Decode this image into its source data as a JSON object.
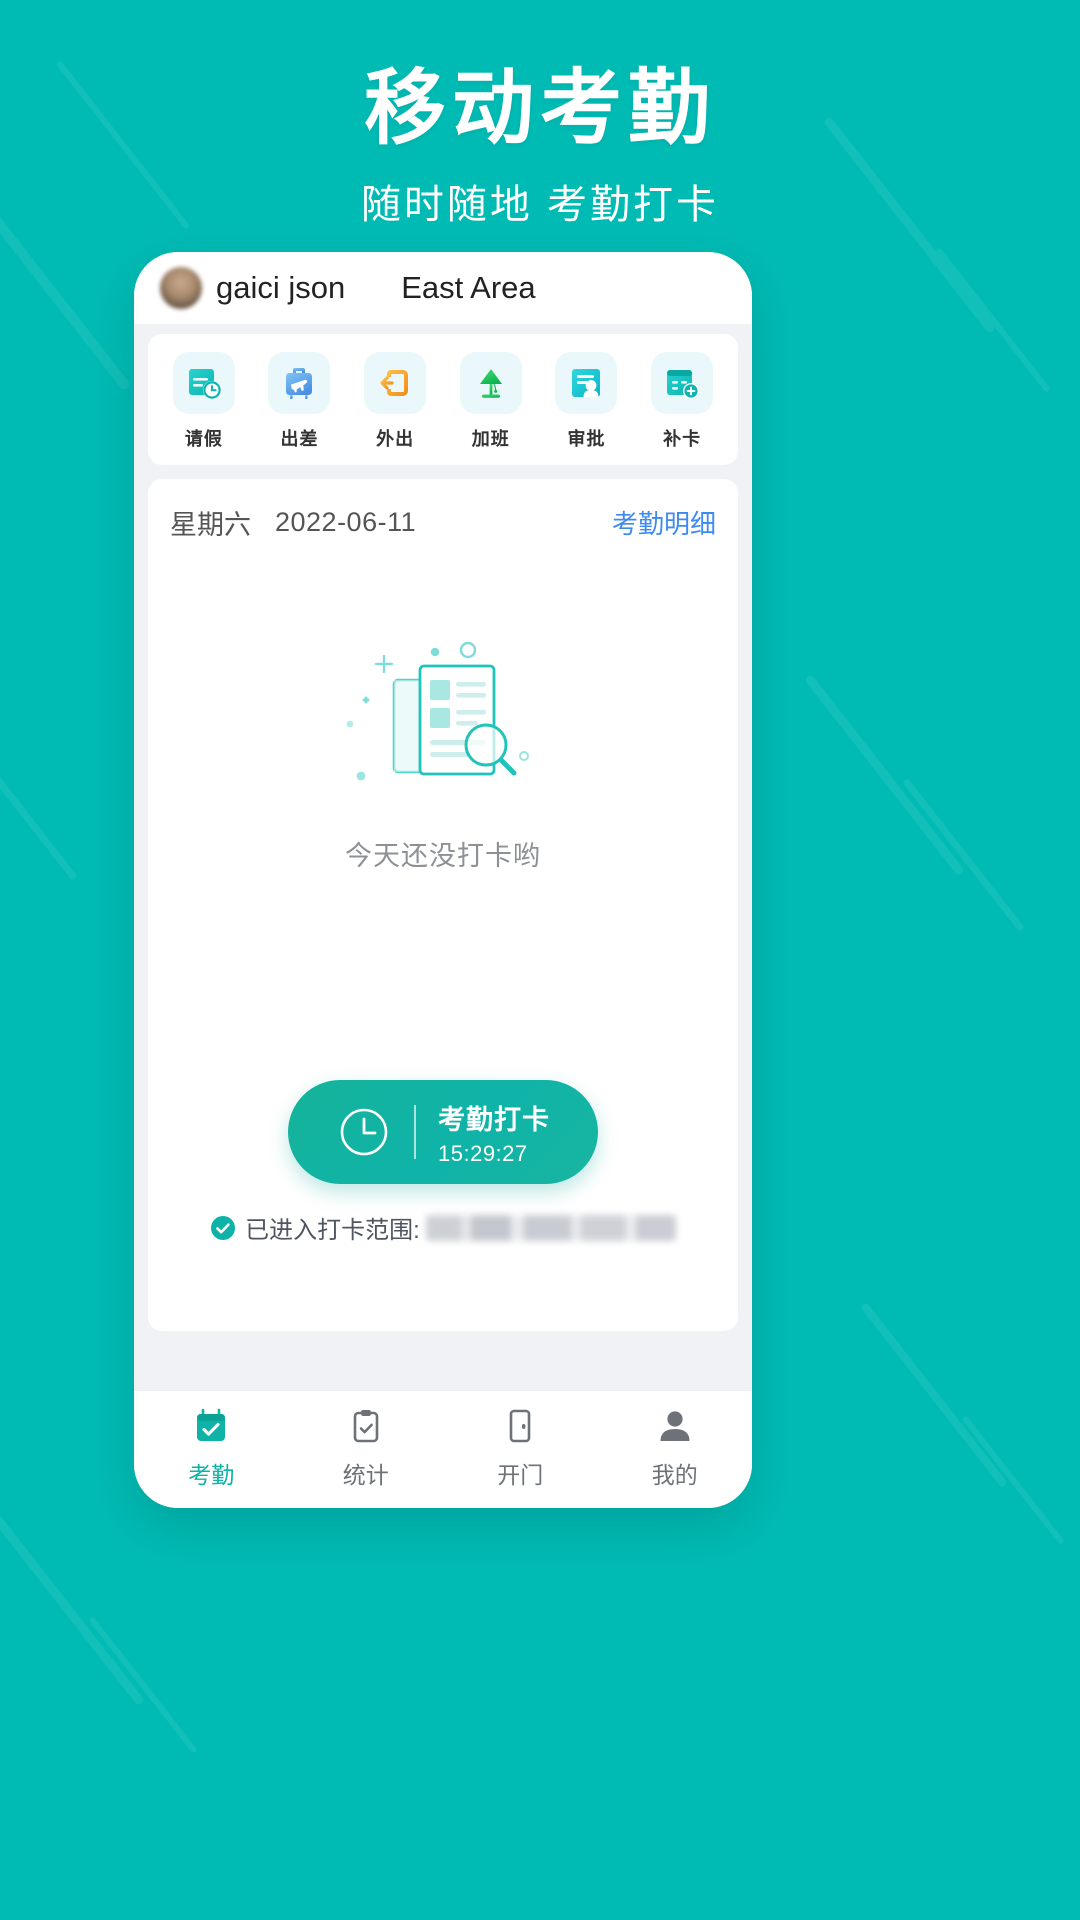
{
  "poster": {
    "title": "移动考勤",
    "subtitle": "随时随地  考勤打卡",
    "brand_color": "#00BBB4"
  },
  "phone": {
    "header": {
      "avatar": "user-avatar",
      "user_name": "gaici json",
      "area_name": "East Area"
    },
    "quick_actions": [
      {
        "label": "请假",
        "icon": "calendar-clock-icon",
        "color": "#15c0c0"
      },
      {
        "label": "出差",
        "icon": "suitcase-plane-icon",
        "color": "#5aa8f0"
      },
      {
        "label": "外出",
        "icon": "door-exit-icon",
        "color": "#f6a321"
      },
      {
        "label": "加班",
        "icon": "desk-lamp-icon",
        "color": "#1bbf5a"
      },
      {
        "label": "审批",
        "icon": "document-person-icon",
        "color": "#16c3d4"
      },
      {
        "label": "补卡",
        "icon": "calendar-plus-icon",
        "color": "#15c0c0"
      }
    ],
    "attendance": {
      "weekday": "星期六",
      "date": "2022-06-11",
      "detail_link": "考勤明细",
      "empty_text": "今天还没打卡哟",
      "empty_illustration": "document-search-empty-icon",
      "punch_button": {
        "icon": "clock-icon",
        "label": "考勤打卡",
        "time": "15:29:27",
        "color": "#0fb3a8"
      },
      "range_status": {
        "icon": "check-circle-icon",
        "label": "已进入打卡范围:",
        "location": "",
        "icon_color": "#0DB3A6"
      }
    },
    "tabbar": [
      {
        "label": "考勤",
        "icon": "attendance-calendar-icon",
        "active": true
      },
      {
        "label": "统计",
        "icon": "clipboard-stats-icon",
        "active": false
      },
      {
        "label": "开门",
        "icon": "door-open-icon",
        "active": false
      },
      {
        "label": "我的",
        "icon": "person-icon",
        "active": false
      }
    ],
    "active_color": "#0DB3A6",
    "inactive_color": "#6c7278"
  }
}
